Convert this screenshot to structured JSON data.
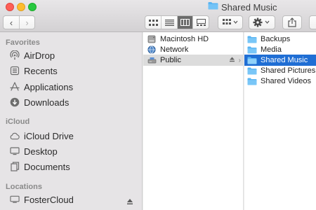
{
  "window": {
    "title": "Shared Music"
  },
  "toolbar": {
    "back_glyph": "‹",
    "forward_glyph": "›"
  },
  "sidebar": {
    "sections": [
      {
        "header": "Favorites",
        "items": [
          {
            "label": "AirDrop",
            "icon": "airdrop-icon"
          },
          {
            "label": "Recents",
            "icon": "recents-icon"
          },
          {
            "label": "Applications",
            "icon": "applications-icon"
          },
          {
            "label": "Downloads",
            "icon": "downloads-icon"
          }
        ]
      },
      {
        "header": "iCloud",
        "items": [
          {
            "label": "iCloud Drive",
            "icon": "cloud-icon"
          },
          {
            "label": "Desktop",
            "icon": "desktop-icon"
          },
          {
            "label": "Documents",
            "icon": "documents-icon"
          }
        ]
      },
      {
        "header": "Locations",
        "items": [
          {
            "label": "FosterCloud",
            "icon": "display-icon"
          }
        ]
      }
    ]
  },
  "columns": {
    "col1": [
      {
        "label": "Macintosh HD",
        "icon": "hard-drive-icon"
      },
      {
        "label": "Network",
        "icon": "network-globe-icon"
      },
      {
        "label": "Public",
        "icon": "shared-drive-icon",
        "state": "selected-inactive"
      }
    ],
    "col2": [
      {
        "label": "Backups",
        "icon": "folder-icon"
      },
      {
        "label": "Media",
        "icon": "folder-icon"
      },
      {
        "label": "Shared Music",
        "icon": "folder-icon",
        "state": "selected"
      },
      {
        "label": "Shared Pictures",
        "icon": "folder-icon"
      },
      {
        "label": "Shared Videos",
        "icon": "folder-icon"
      }
    ]
  },
  "colors": {
    "selection": "#1f6ed4",
    "folder": "#5ab4f2",
    "sidebar_bg": "#e6e4e6"
  }
}
